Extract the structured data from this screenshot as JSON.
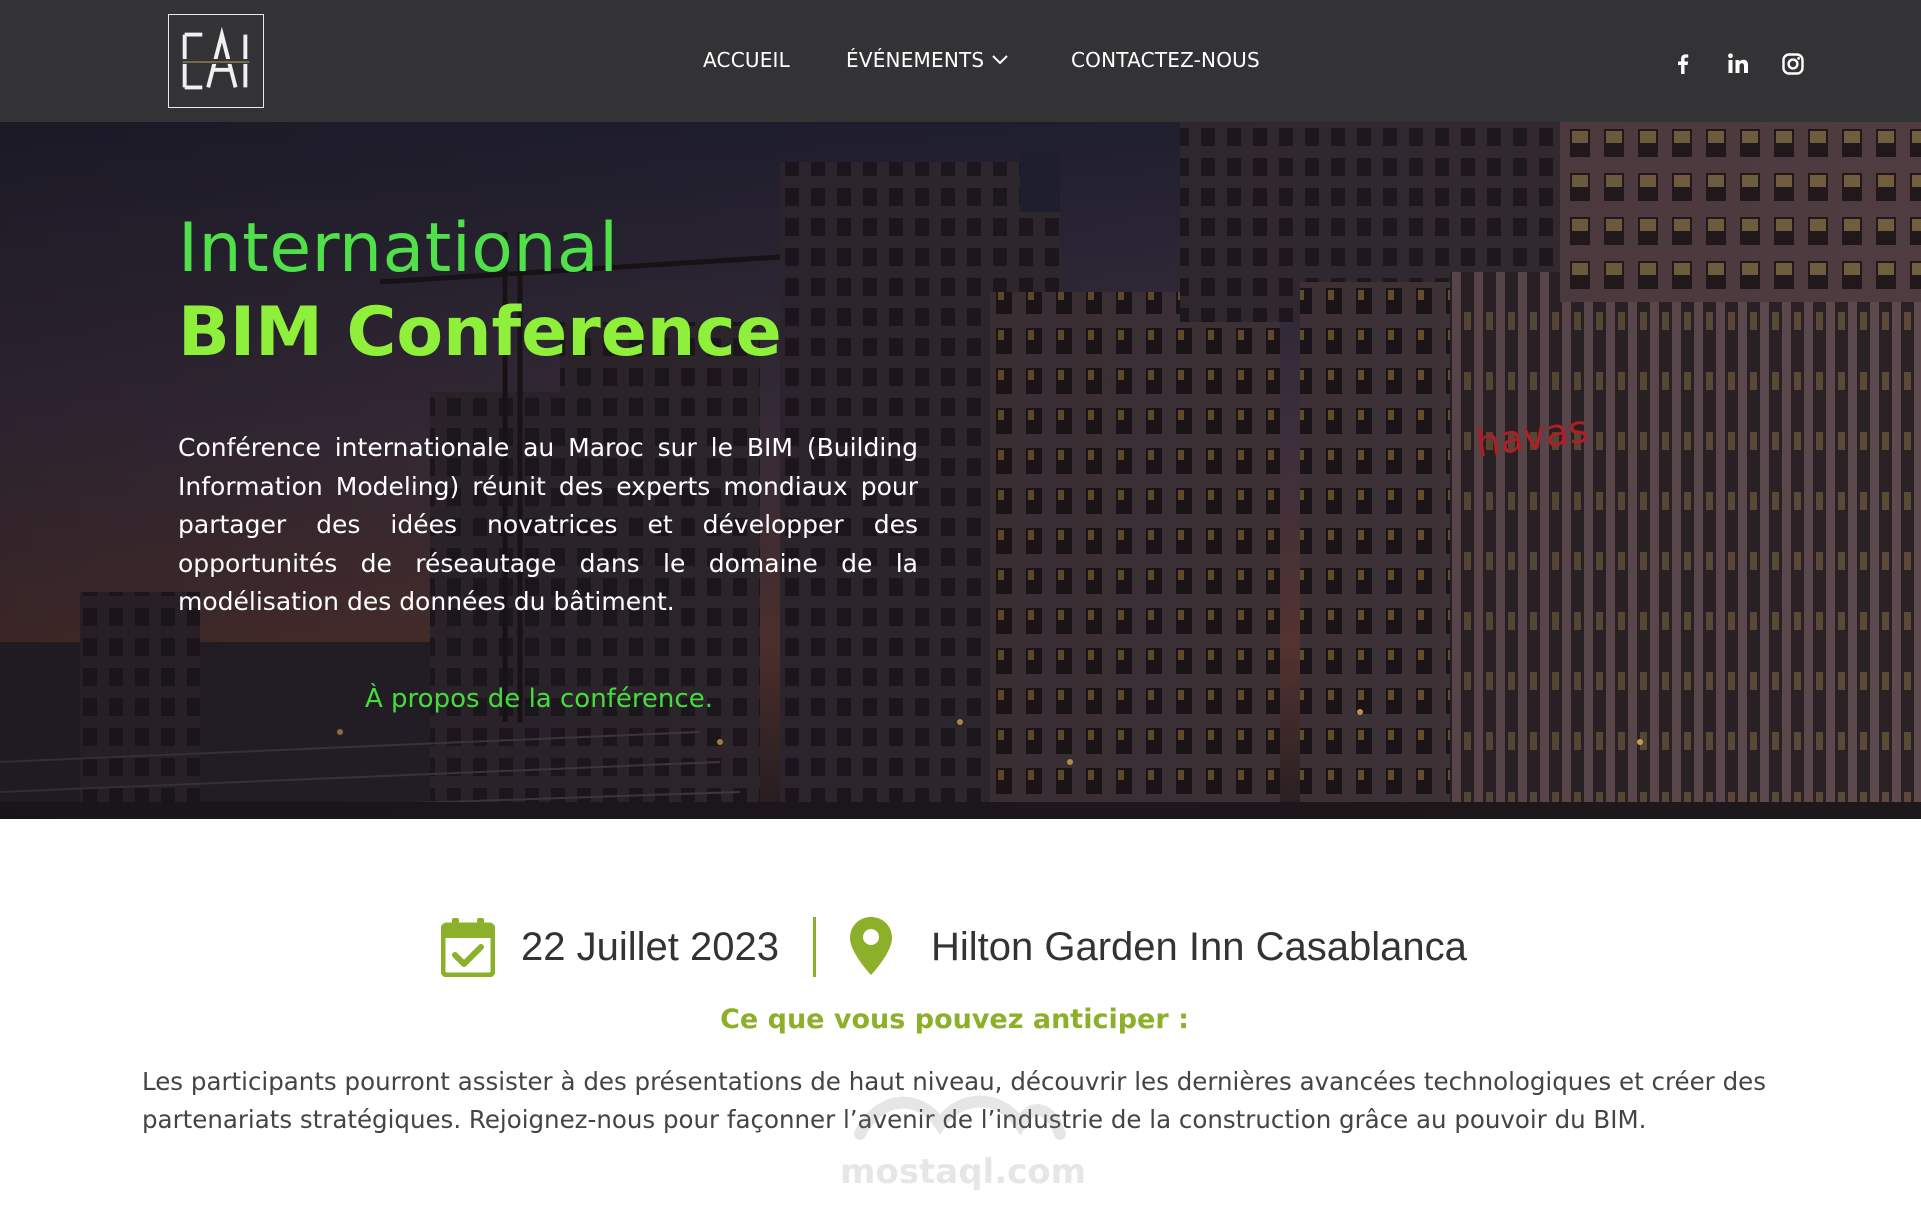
{
  "nav": {
    "items": [
      {
        "label": "ACCUEIL"
      },
      {
        "label": "ÉVÉNEMENTS"
      },
      {
        "label": "CONTACTEZ-NOUS"
      }
    ],
    "social": [
      "facebook-icon",
      "linkedin-icon",
      "instagram-icon"
    ]
  },
  "hero": {
    "title_line1": "International",
    "title_line2": "BIM Conference",
    "description": "Conférence internationale au Maroc sur le BIM (Building Information Modeling) réunit des experts mondiaux pour partager des idées novatrices et développer des opportunités de réseautage dans le domaine de la modélisation des données du bâtiment.",
    "sign_text": "havas",
    "link_label": "À propos de la conférence."
  },
  "event": {
    "date": "22 Juillet 2023",
    "venue": "Hilton Garden Inn Casablanca",
    "anticipate_title": "Ce que vous pouvez anticiper :",
    "body": "Les participants pourront assister à des présentations de haut niveau, découvrir les dernières avancées technologiques et créer des partenariats stratégiques. Rejoignez-nous pour façonner l’avenir de l’industrie de la construction grâce au pouvoir du BIM."
  },
  "watermark": {
    "text": "mostaql.com"
  },
  "colors": {
    "nav_bg": "#333336",
    "accent_green": "#8db02a",
    "hero_green": "#4fe04a",
    "hero_lime": "#8ef03a",
    "link_green": "#44dd3a"
  }
}
